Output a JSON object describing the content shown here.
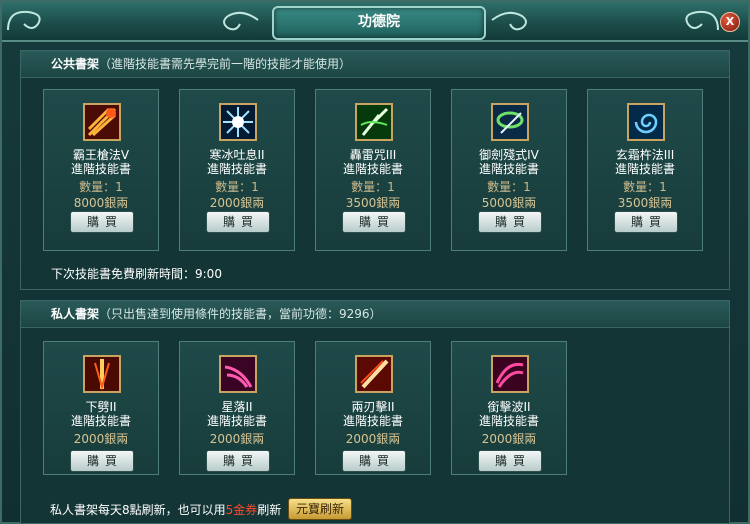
{
  "window": {
    "title": "功德院",
    "close_label": "X"
  },
  "public_shelf": {
    "title": "公共書架",
    "note": "（進階技能書需先學完前一階的技能才能使用）",
    "refresh_text": "下次技能書免費刷新時間：9:00",
    "items": [
      {
        "name": "霸王槍法V",
        "type": "進階技能書",
        "qty": "數量：1",
        "price": "8000銀兩",
        "buy": "購買",
        "icon": "spear-burst-icon",
        "color": "#e0451b"
      },
      {
        "name": "寒冰吐息II",
        "type": "進階技能書",
        "qty": "數量：1",
        "price": "2000銀兩",
        "buy": "購買",
        "icon": "ice-burst-icon",
        "color": "#2aa6e8"
      },
      {
        "name": "轟雷咒III",
        "type": "進階技能書",
        "qty": "數量：1",
        "price": "3500銀兩",
        "buy": "購買",
        "icon": "thunder-spell-icon",
        "color": "#3bbf3a"
      },
      {
        "name": "御劍殘式IV",
        "type": "進階技能書",
        "qty": "數量：1",
        "price": "5000銀兩",
        "buy": "購買",
        "icon": "flying-sword-icon",
        "color": "#2f8a4a"
      },
      {
        "name": "玄霜杵法III",
        "type": "進階技能書",
        "qty": "數量：1",
        "price": "3500銀兩",
        "buy": "購買",
        "icon": "frost-swirl-icon",
        "color": "#1f7fd6"
      }
    ]
  },
  "private_shelf": {
    "title": "私人書架",
    "note": "（只出售達到使用條件的技能書，當前功德：9296）",
    "items": [
      {
        "name": "下劈II",
        "type": "進階技能書",
        "price": "2000銀兩",
        "buy": "購買",
        "icon": "down-slash-icon",
        "color": "#d63a12"
      },
      {
        "name": "星落II",
        "type": "進階技能書",
        "price": "2000銀兩",
        "buy": "購買",
        "icon": "star-fall-icon",
        "color": "#c0216a"
      },
      {
        "name": "兩刃擊II",
        "type": "進階技能書",
        "price": "2000銀兩",
        "buy": "購買",
        "icon": "twin-blade-icon",
        "color": "#e0301a"
      },
      {
        "name": "銜擊波II",
        "type": "進階技能書",
        "price": "2000銀兩",
        "buy": "購買",
        "icon": "wave-strike-icon",
        "color": "#b5186a"
      }
    ]
  },
  "footer": {
    "text_before": "私人書架每天8點刷新，也可以用",
    "gold_text": "5金券",
    "text_after": "刷新",
    "refresh_button": "元寶刷新"
  }
}
